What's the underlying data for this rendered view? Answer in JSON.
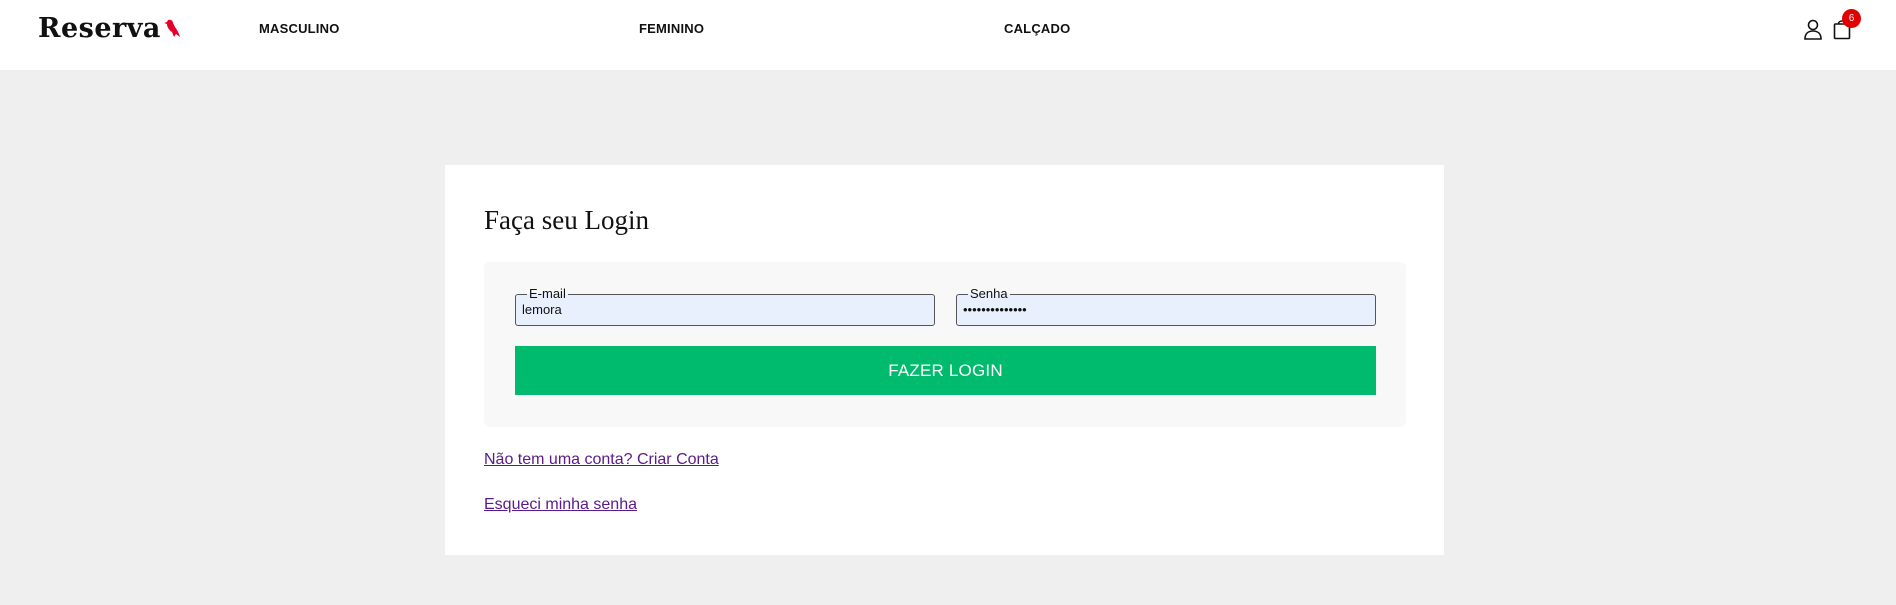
{
  "header": {
    "logo_text": "Reserva",
    "nav": [
      "MASCULINO",
      "FEMININO",
      "CALÇADO"
    ],
    "cart_count": "6",
    "icons": {
      "account": "user-icon",
      "cart": "shopping-bag-icon",
      "logo_mark": "bird-icon"
    },
    "accent_color": "#e4002b"
  },
  "login": {
    "title": "Faça seu Login",
    "email": {
      "label": "E-mail",
      "value": "lemora"
    },
    "password": {
      "label": "Senha",
      "value": "••••••••••••••"
    },
    "submit_label": "FAZER LOGIN",
    "submit_color": "#00bb6d",
    "create_account_link": "Não tem uma conta? Criar Conta",
    "forgot_password_link": "Esqueci minha senha"
  }
}
